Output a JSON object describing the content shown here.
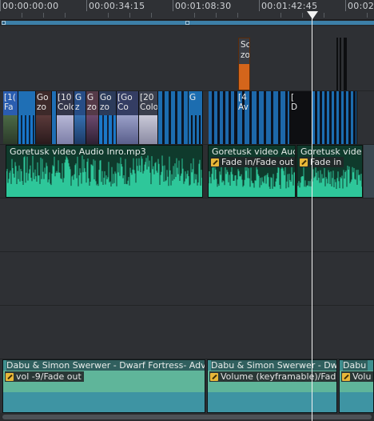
{
  "ruler": {
    "timecodes": [
      "00:00:00:00",
      "00:00:34:15",
      "00:01:08:30",
      "00:01:42:45",
      "00:02"
    ]
  },
  "tracks": {
    "title_track": {
      "clip_label_top": "Sc",
      "clip_label_bottom": "zo"
    },
    "video_track": {
      "segments": [
        {
          "label": "[1(\nFa",
          "color": "#2a5db0"
        },
        {
          "label": "",
          "color": "#1f6fb5"
        },
        {
          "label": "Go\nzo",
          "color": "#3d2a2a"
        },
        {
          "label": "",
          "color": "#1f6fb5"
        },
        {
          "label": "[10\nColo",
          "color": "#33364a"
        },
        {
          "label": "G\nz",
          "color": "#274d86"
        },
        {
          "label": "G\nzo",
          "color": "#553a48"
        },
        {
          "label": "Go\nzo",
          "color": "#2c3b5a"
        },
        {
          "label": "[Go\nCo",
          "color": "#343d63"
        },
        {
          "label": "[20\nColo",
          "color": "#3a3f4d"
        },
        {
          "label": "",
          "color": "#1c6db0"
        },
        {
          "label": "G\n",
          "color": "#1c6db0"
        },
        {
          "label": "[4\nAv",
          "color": "#1d68aa"
        },
        {
          "label": "[\nD",
          "color": "#0e0f12"
        },
        {
          "label": "",
          "color": "#1c6db0"
        }
      ]
    },
    "audio_track": {
      "clips": [
        {
          "title": "Goretusk video Audio Inro.mp3",
          "effect": ""
        },
        {
          "title": "Goretusk video Audio",
          "effect": "Fade in/Fade out"
        },
        {
          "title": "Goretusk video",
          "effect": "Fade in"
        }
      ]
    },
    "music_track": {
      "clips": [
        {
          "title": "Dabu & Simon Swerwer - Dwarf Fortress- Adv",
          "effect": "vol -9/Fade out"
        },
        {
          "title": "Dabu & Simon Swerwer - Dw",
          "effect": "Volume (keyframable)/Fad"
        },
        {
          "title": "Dabu",
          "effect": "Volu"
        }
      ]
    }
  },
  "colors": {
    "accent": "#3c7fa8",
    "audio_wave": "#2ec79a",
    "title_clip": "#d9661c",
    "playhead": "#f2f2f2"
  },
  "icons": {
    "effect_badge": "pencil-badge-icon",
    "playhead_marker": "triangle-down-icon"
  }
}
